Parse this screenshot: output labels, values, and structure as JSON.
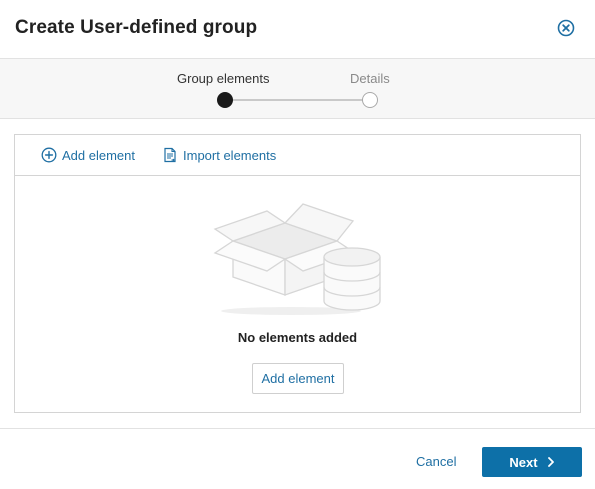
{
  "dialog": {
    "title": "Create User-defined group"
  },
  "stepper": {
    "steps": [
      {
        "label": "Group elements",
        "state": "active"
      },
      {
        "label": "Details",
        "state": "inactive"
      }
    ]
  },
  "toolbar": {
    "add_label": "Add element",
    "add_icon": "plus-circle-icon",
    "import_label": "Import elements",
    "import_icon": "import-document-icon"
  },
  "empty_state": {
    "message": "No elements added",
    "add_button_label": "Add element",
    "illustration": "box-and-database"
  },
  "footer": {
    "cancel_label": "Cancel",
    "next_label": "Next"
  },
  "colors": {
    "accent": "#1f6fa3",
    "primary_button": "#0d70a8",
    "step_active": "#1a1a1a"
  }
}
